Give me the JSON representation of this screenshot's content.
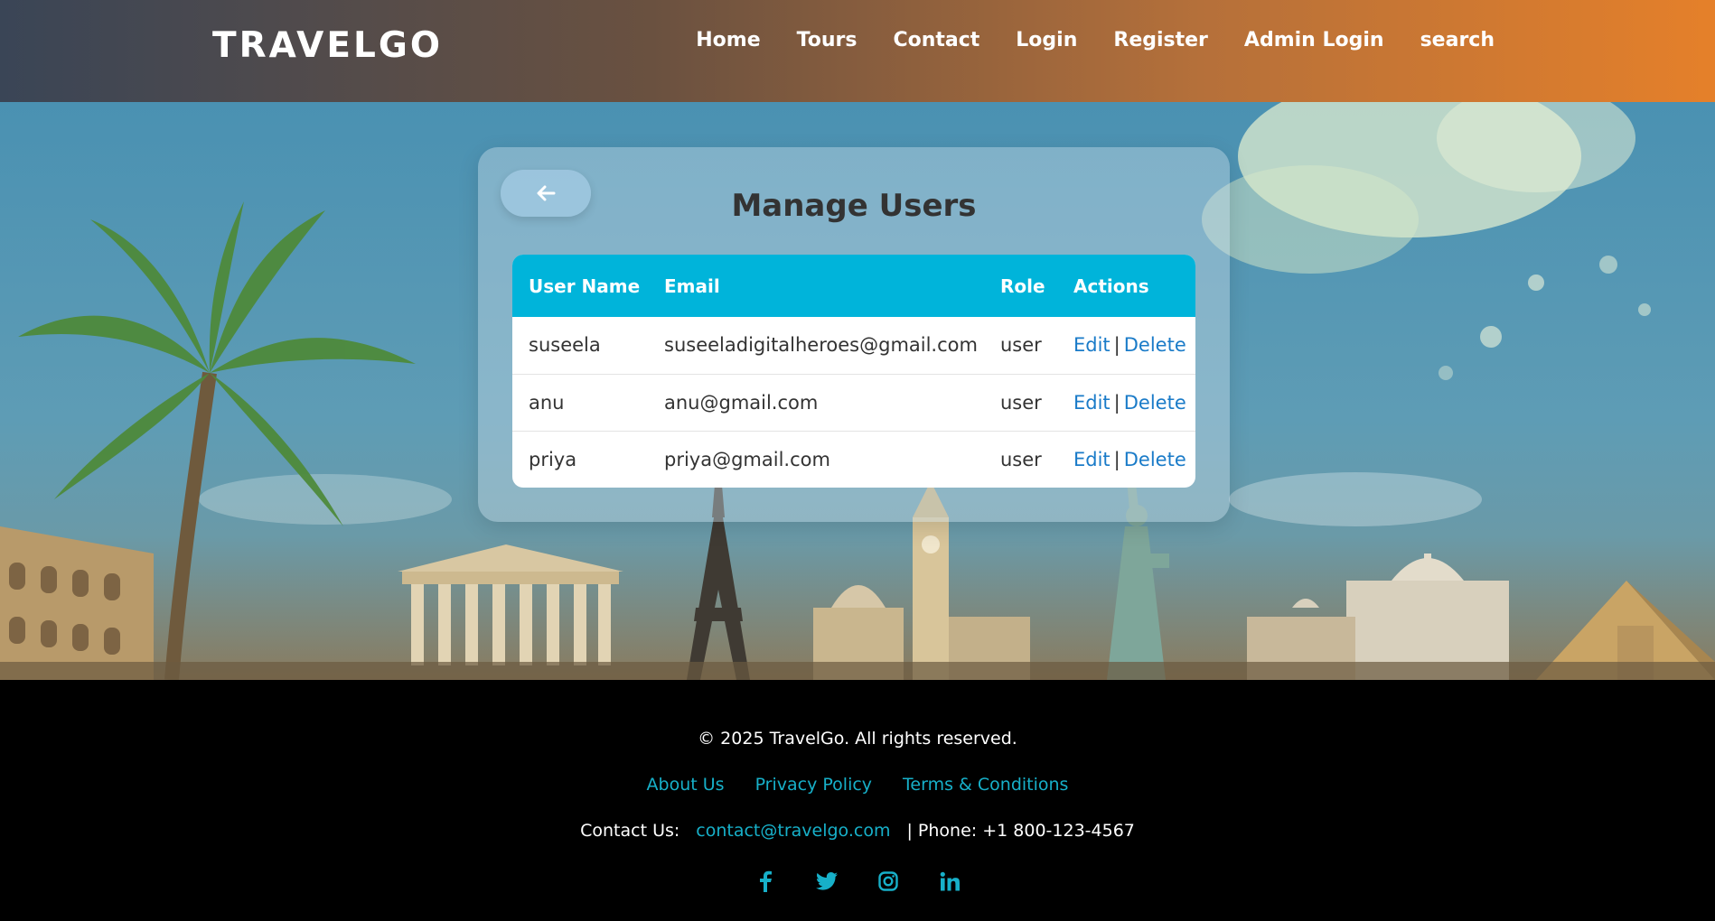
{
  "header": {
    "logo": "TRAVELGO",
    "nav": [
      "Home",
      "Tours",
      "Contact",
      "Login",
      "Register",
      "Admin Login",
      "search"
    ]
  },
  "card": {
    "back_icon": "arrow-left-icon",
    "title": "Manage Users",
    "table": {
      "headers": [
        "User Name",
        "Email",
        "Role",
        "Actions"
      ],
      "rows": [
        {
          "name": "suseela",
          "email": "suseeladigitalheroes@gmail.com",
          "role": "user",
          "edit": "Edit",
          "sep": "|",
          "delete": "Delete"
        },
        {
          "name": "anu",
          "email": "anu@gmail.com",
          "role": "user",
          "edit": "Edit",
          "sep": "|",
          "delete": "Delete"
        },
        {
          "name": "priya",
          "email": "priya@gmail.com",
          "role": "user",
          "edit": "Edit",
          "sep": "|",
          "delete": "Delete"
        }
      ]
    }
  },
  "footer": {
    "copyright": "© 2025 TravelGo. All rights reserved.",
    "links": [
      "About Us",
      "Privacy Policy",
      "Terms & Conditions"
    ],
    "contact_label": "Contact Us:",
    "contact_email": "contact@travelgo.com",
    "phone": "| Phone: +1 800-123-4567",
    "socials": [
      "facebook-icon",
      "twitter-icon",
      "instagram-icon",
      "linkedin-icon"
    ]
  },
  "colors": {
    "accent": "#00b4da",
    "link": "#17b0c9",
    "action_link": "#1a7bc8",
    "header_start": "#3a4556",
    "header_end": "#e5802a"
  }
}
